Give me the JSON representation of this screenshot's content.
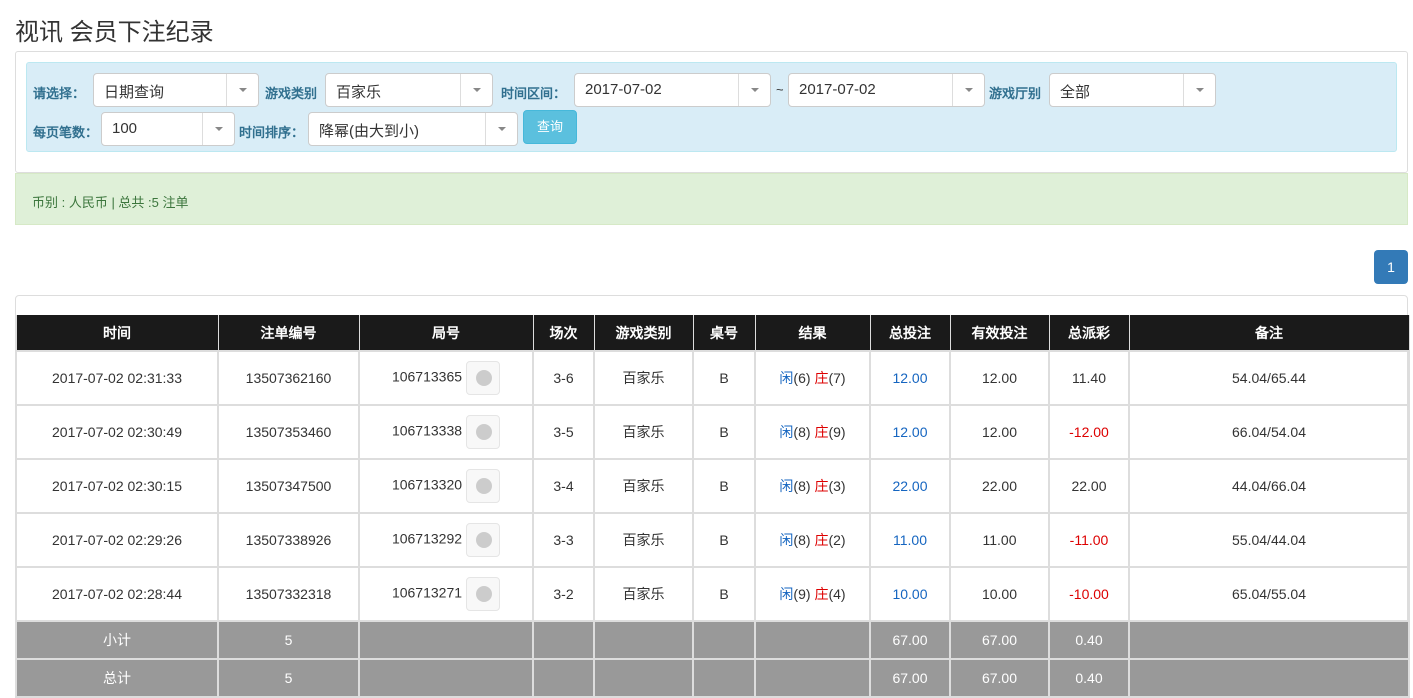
{
  "title": "视讯 会员下注纪录",
  "filters": {
    "select_label": "请选择：",
    "select_value": "日期查询",
    "game_type_label": "游戏类别",
    "game_type_value": "百家乐",
    "range_label": "时间区间：",
    "range_start": "2017-07-02",
    "range_sep": "~",
    "range_end": "2017-07-02",
    "hall_label": "游戏厅别",
    "hall_value": "全部",
    "per_page_label": "每页笔数：",
    "per_page_value": "100",
    "sort_label": "时间排序：",
    "sort_value": "降幂(由大到小)",
    "query_button": "查询"
  },
  "summary": "币别 : 人民币 | 总共 :5 注单",
  "pagination": {
    "current": "1"
  },
  "table": {
    "headers": [
      "时间",
      "注单编号",
      "局号",
      "场次",
      "游戏类别",
      "桌号",
      "结果",
      "总投注",
      "有效投注",
      "总派彩",
      "备注"
    ],
    "rows": [
      {
        "time": "2017-07-02 02:31:33",
        "bet_id": "13507362160",
        "round": "106713365",
        "session": "3-6",
        "game": "百家乐",
        "table": "B",
        "player": "闲",
        "player_pts": "(6)",
        "banker": "庄",
        "banker_pts": "(7)",
        "total_bet": "12.00",
        "valid_bet": "12.00",
        "payout": "11.40",
        "payout_neg": false,
        "note": "54.04/65.44"
      },
      {
        "time": "2017-07-02 02:30:49",
        "bet_id": "13507353460",
        "round": "106713338",
        "session": "3-5",
        "game": "百家乐",
        "table": "B",
        "player": "闲",
        "player_pts": "(8)",
        "banker": "庄",
        "banker_pts": "(9)",
        "total_bet": "12.00",
        "valid_bet": "12.00",
        "payout": "-12.00",
        "payout_neg": true,
        "note": "66.04/54.04"
      },
      {
        "time": "2017-07-02 02:30:15",
        "bet_id": "13507347500",
        "round": "106713320",
        "session": "3-4",
        "game": "百家乐",
        "table": "B",
        "player": "闲",
        "player_pts": "(8)",
        "banker": "庄",
        "banker_pts": "(3)",
        "total_bet": "22.00",
        "valid_bet": "22.00",
        "payout": "22.00",
        "payout_neg": false,
        "note": "44.04/66.04"
      },
      {
        "time": "2017-07-02 02:29:26",
        "bet_id": "13507338926",
        "round": "106713292",
        "session": "3-3",
        "game": "百家乐",
        "table": "B",
        "player": "闲",
        "player_pts": "(8)",
        "banker": "庄",
        "banker_pts": "(2)",
        "total_bet": "11.00",
        "valid_bet": "11.00",
        "payout": "-11.00",
        "payout_neg": true,
        "note": "55.04/44.04"
      },
      {
        "time": "2017-07-02 02:28:44",
        "bet_id": "13507332318",
        "round": "106713271",
        "session": "3-2",
        "game": "百家乐",
        "table": "B",
        "player": "闲",
        "player_pts": "(9)",
        "banker": "庄",
        "banker_pts": "(4)",
        "total_bet": "10.00",
        "valid_bet": "10.00",
        "payout": "-10.00",
        "payout_neg": true,
        "note": "65.04/55.04"
      }
    ],
    "subtotal": {
      "label": "小计",
      "count": "5",
      "total_bet": "67.00",
      "valid_bet": "67.00",
      "payout": "0.40"
    },
    "total": {
      "label": "总计",
      "count": "5",
      "total_bet": "67.00",
      "valid_bet": "67.00",
      "payout": "0.40"
    }
  }
}
